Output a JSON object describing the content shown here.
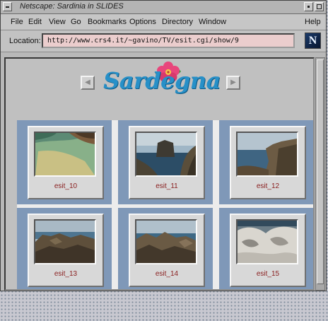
{
  "window": {
    "title": "Netscape: Sardinia in SLIDES"
  },
  "menubar": {
    "items": [
      "File",
      "Edit",
      "View",
      "Go",
      "Bookmarks",
      "Options",
      "Directory",
      "Window"
    ],
    "help": "Help"
  },
  "location": {
    "label": "Location:",
    "url": "http://www.crs4.it/~gavino/TV/esit.cgi/show/9",
    "browser_logo": "N"
  },
  "page": {
    "logo_text": "Sardegna",
    "prev_icon": "left-arrow-icon",
    "next_icon": "right-arrow-icon"
  },
  "gallery": {
    "items": [
      {
        "label": "esit_10",
        "scene": "cove"
      },
      {
        "label": "esit_11",
        "scene": "sea-stack"
      },
      {
        "label": "esit_12",
        "scene": "cliff-right"
      },
      {
        "label": "esit_13",
        "scene": "rocky-shore"
      },
      {
        "label": "esit_14",
        "scene": "rocky-shore-2"
      },
      {
        "label": "esit_15",
        "scene": "granite-rocks"
      }
    ]
  },
  "colors": {
    "accent_blue": "#2790c8",
    "cell_blue": "#7f98b8",
    "label_red": "#8a2020",
    "location_bg": "#ebcdcd"
  }
}
